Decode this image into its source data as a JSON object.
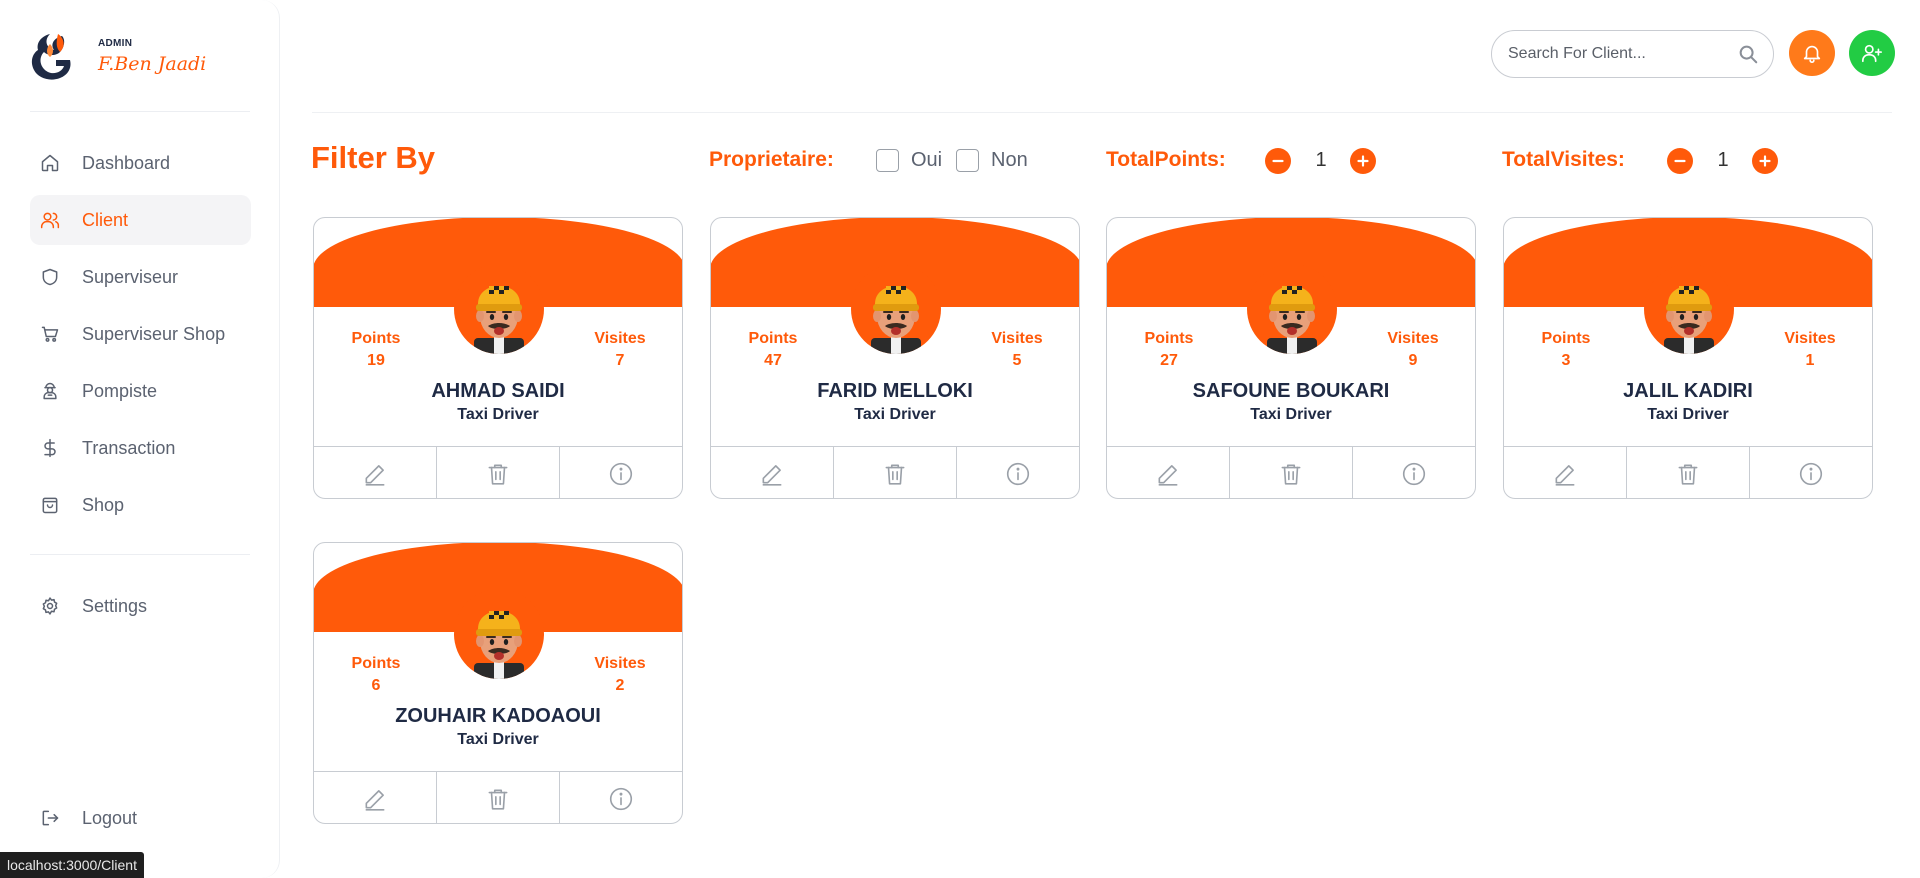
{
  "brand": {
    "role": "ADMIN",
    "name": "F.Ben Jaadi"
  },
  "sidebar": {
    "items": [
      {
        "label": "Dashboard",
        "icon": "home-icon"
      },
      {
        "label": "Client",
        "icon": "users-icon",
        "active": true
      },
      {
        "label": "Superviseur",
        "icon": "shield-icon"
      },
      {
        "label": "Superviseur Shop",
        "icon": "cart-icon"
      },
      {
        "label": "Pompiste",
        "icon": "worker-icon"
      },
      {
        "label": "Transaction",
        "icon": "dollar-icon"
      },
      {
        "label": "Shop",
        "icon": "bag-icon"
      }
    ],
    "settings": "Settings",
    "logout": "Logout"
  },
  "search": {
    "placeholder": "Search For Client..."
  },
  "filter": {
    "title": "Filter By",
    "proprietaire_label": "Proprietaire:",
    "oui": "Oui",
    "non": "Non",
    "totalpoints_label": "TotalPoints:",
    "totalpoints_value": "1",
    "totalvisites_label": "TotalVisites:",
    "totalvisites_value": "1"
  },
  "cards": [
    {
      "name": "AHMAD SAIDI",
      "role": "Taxi Driver",
      "points_label": "Points",
      "points": "19",
      "visites_label": "Visites",
      "visites": "7"
    },
    {
      "name": "FARID MELLOKI",
      "role": "Taxi Driver",
      "points_label": "Points",
      "points": "47",
      "visites_label": "Visites",
      "visites": "5"
    },
    {
      "name": "SAFOUNE BOUKARI",
      "role": "Taxi Driver",
      "points_label": "Points",
      "points": "27",
      "visites_label": "Visites",
      "visites": "9"
    },
    {
      "name": "JALIL KADIRI",
      "role": "Taxi Driver",
      "points_label": "Points",
      "points": "3",
      "visites_label": "Visites",
      "visites": "1"
    },
    {
      "name": "ZOUHAIR KADOAOUI",
      "role": "Taxi Driver",
      "points_label": "Points",
      "points": "6",
      "visites_label": "Visites",
      "visites": "2"
    }
  ],
  "statusbar": {
    "url": "localhost:3000/Client"
  },
  "colors": {
    "accent": "#ff5a0a",
    "notify": "#ff7a1a",
    "add_user": "#22cc44",
    "text_dark": "#1f2a44"
  }
}
